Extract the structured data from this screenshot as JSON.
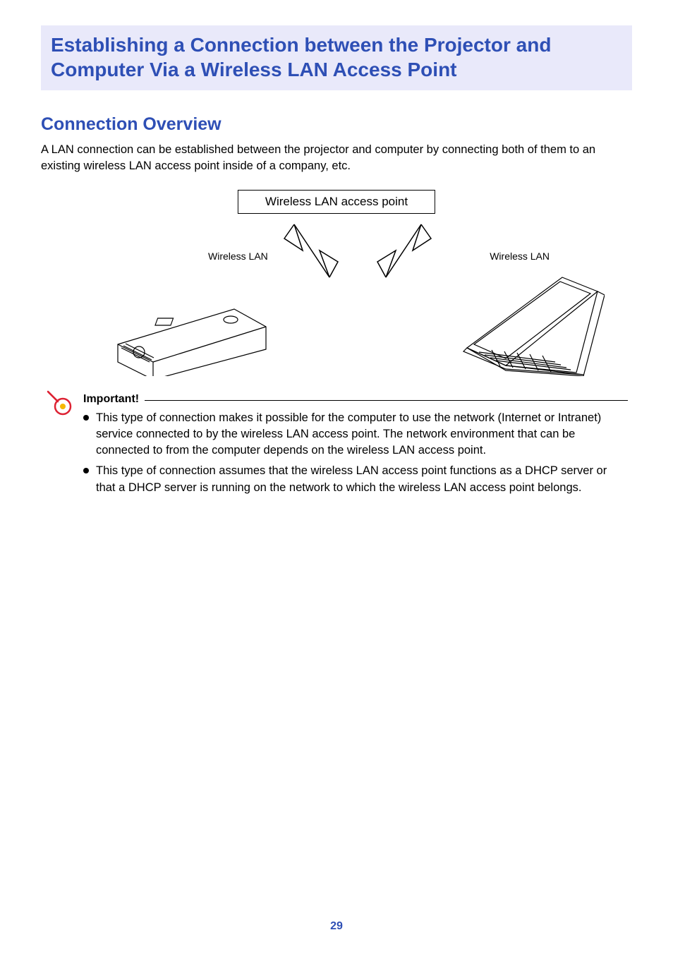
{
  "heading_main": "Establishing a Connection between the Projector and Computer Via a Wireless LAN Access Point",
  "heading_sub": "Connection Overview",
  "intro": "A LAN connection can be established between the projector and computer by connecting both of them to an existing wireless LAN access point inside of a company, etc.",
  "diagram": {
    "access_point_label": "Wireless LAN access point",
    "wlan_label_left": "Wireless LAN",
    "wlan_label_right": "Wireless LAN"
  },
  "important": {
    "label": "Important!",
    "bullets": [
      "This type of connection makes it possible for the computer to use the network (Internet or Intranet) service connected to by the wireless LAN access point. The network environment that can be connected to from the computer depends on the wireless LAN access point.",
      "This type of connection assumes that the wireless LAN access point functions as a DHCP server or that a DHCP server is running on the network to which the wireless LAN access point belongs."
    ]
  },
  "page_number": "29"
}
